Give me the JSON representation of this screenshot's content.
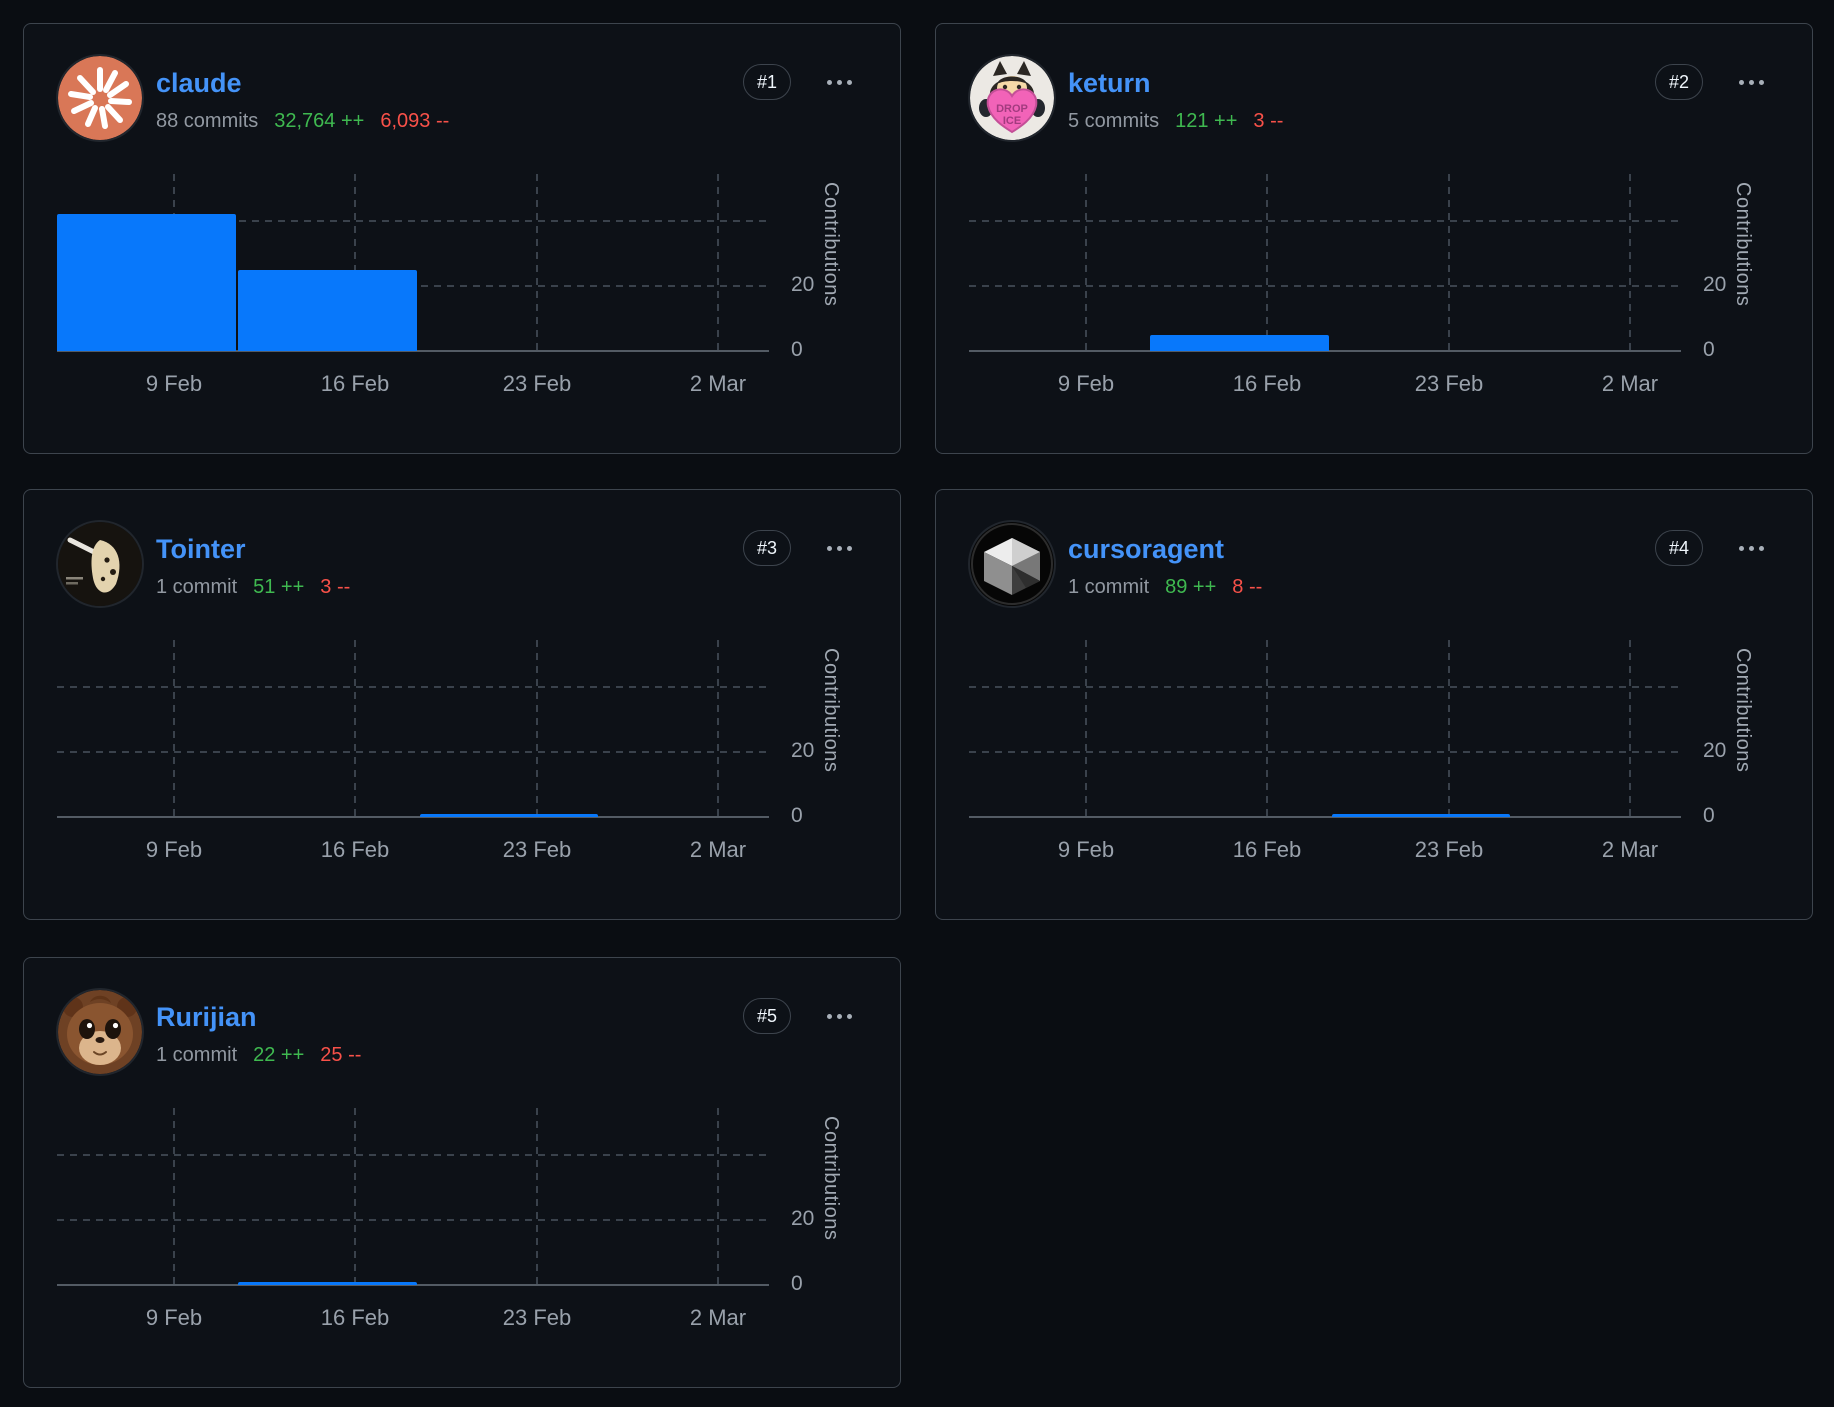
{
  "colors": {
    "page_bg": "#0a0d12",
    "card_bg": "#0d1117",
    "card_border": "#3d444d",
    "bar_blue": "#0878fb",
    "username_link_blue": "#4493f8",
    "additions_green": "#3fb950",
    "deletions_red": "#f85149",
    "muted_text": "#9198a1",
    "badge_text": "#f0f6fc"
  },
  "cards": [
    {
      "rank_badge": "#1",
      "username": "claude",
      "commits": "88 commits",
      "additions": "32,764 ++",
      "deletions": "6,093 --",
      "avatar_icon": "claude-starburst-logo",
      "menu_icon": "kebab-menu",
      "chart_data": {
        "type": "bar",
        "x": [
          "9 Feb",
          "16 Feb",
          "23 Feb",
          "2 Mar"
        ],
        "values": [
          42,
          25,
          0,
          0
        ],
        "ylabel": "Contributions",
        "ylim": [
          0,
          60
        ],
        "y_gridlines": [
          20,
          40
        ],
        "y_ticks": [
          {
            "label": "20",
            "value": 20
          },
          {
            "label": "0",
            "value": 0
          }
        ]
      }
    },
    {
      "rank_badge": "#2",
      "username": "keturn",
      "commits": "5 commits",
      "additions": "121 ++",
      "deletions": "3 --",
      "avatar_icon": "octocat-heart-drop-ice",
      "menu_icon": "kebab-menu",
      "chart_data": {
        "type": "bar",
        "x": [
          "9 Feb",
          "16 Feb",
          "23 Feb",
          "2 Mar"
        ],
        "values": [
          0,
          5,
          0,
          0
        ],
        "ylabel": "Contributions",
        "ylim": [
          0,
          60
        ],
        "y_gridlines": [
          20,
          40
        ],
        "y_ticks": [
          {
            "label": "20",
            "value": 20
          },
          {
            "label": "0",
            "value": 0
          }
        ]
      }
    },
    {
      "rank_badge": "#3",
      "username": "Tointer",
      "commits": "1 commit",
      "additions": "51 ++",
      "deletions": "3 --",
      "avatar_icon": "dark-photo-sculpture",
      "menu_icon": "kebab-menu",
      "chart_data": {
        "type": "bar",
        "x": [
          "9 Feb",
          "16 Feb",
          "23 Feb",
          "2 Mar"
        ],
        "values": [
          0,
          0,
          1,
          0
        ],
        "ylabel": "Contributions",
        "ylim": [
          0,
          60
        ],
        "y_gridlines": [
          20,
          40
        ],
        "y_ticks": [
          {
            "label": "20",
            "value": 20
          },
          {
            "label": "0",
            "value": 0
          }
        ]
      }
    },
    {
      "rank_badge": "#4",
      "username": "cursoragent",
      "commits": "1 commit",
      "additions": "89 ++",
      "deletions": "8 --",
      "avatar_icon": "cursor-cube-logo",
      "menu_icon": "kebab-menu",
      "chart_data": {
        "type": "bar",
        "x": [
          "9 Feb",
          "16 Feb",
          "23 Feb",
          "2 Mar"
        ],
        "values": [
          0,
          0,
          1,
          0
        ],
        "ylabel": "Contributions",
        "ylim": [
          0,
          60
        ],
        "y_gridlines": [
          20,
          40
        ],
        "y_ticks": [
          {
            "label": "20",
            "value": 20
          },
          {
            "label": "0",
            "value": 0
          }
        ]
      }
    },
    {
      "rank_badge": "#5",
      "username": "Rurijian",
      "commits": "1 commit",
      "additions": "22 ++",
      "deletions": "25 --",
      "avatar_icon": "chipmunk-face",
      "menu_icon": "kebab-menu",
      "chart_data": {
        "type": "bar",
        "x": [
          "9 Feb",
          "16 Feb",
          "23 Feb",
          "2 Mar"
        ],
        "values": [
          0,
          1,
          0,
          0
        ],
        "ylabel": "Contributions",
        "ylim": [
          0,
          60
        ],
        "y_gridlines": [
          20,
          40
        ],
        "y_ticks": [
          {
            "label": "20",
            "value": 20
          },
          {
            "label": "0",
            "value": 0
          }
        ]
      }
    }
  ]
}
